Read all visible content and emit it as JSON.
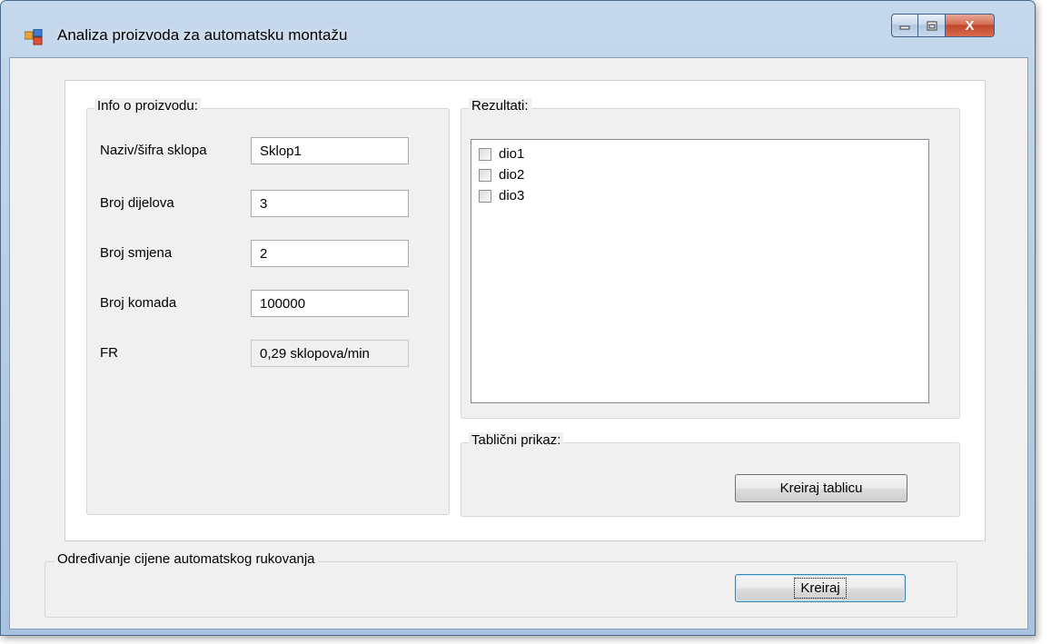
{
  "window": {
    "title": "Analiza proizvoda za automatsku montažu",
    "close_glyph": "X"
  },
  "info": {
    "title": "Info o proizvodu:",
    "fields": [
      {
        "label": "Naziv/šifra sklopa",
        "value": "Sklop1"
      },
      {
        "label": "Broj dijelova",
        "value": "3"
      },
      {
        "label": "Broj smjena",
        "value": "2"
      },
      {
        "label": "Broj komada",
        "value": "100000"
      },
      {
        "label": "FR",
        "value": "0,29 sklopova/min"
      }
    ]
  },
  "rezultati": {
    "title": "Rezultati:",
    "items": [
      "dio1",
      "dio2",
      "dio3"
    ]
  },
  "tablicni": {
    "title": "Tablični prikaz:",
    "button": "Kreiraj tablicu"
  },
  "odredivanje": {
    "title": "Određivanje cijene automatskog rukovanja",
    "button": "Kreiraj"
  },
  "icons": {
    "app": "app-window-icon",
    "minimize": "minimize-icon",
    "maximize": "maximize-icon",
    "close": "close-icon"
  }
}
